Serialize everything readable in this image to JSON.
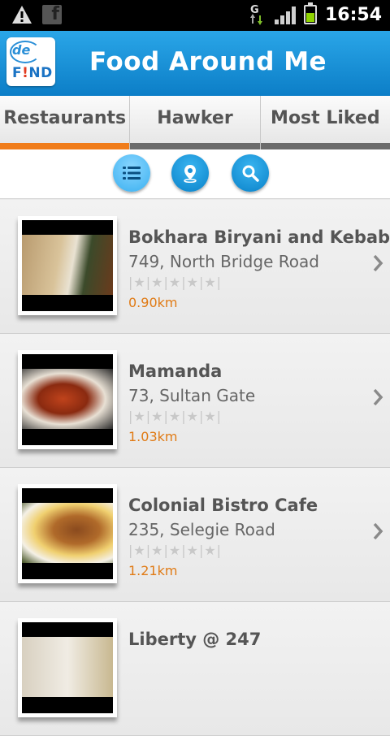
{
  "status_bar": {
    "time": "16:54",
    "icons": [
      "warning-icon",
      "facebook-icon",
      "network-g-icon",
      "signal-icon",
      "battery-icon"
    ]
  },
  "header": {
    "logo_de": "de",
    "logo_find": "FIND",
    "title": "Food Around Me",
    "color": "#1a93dc"
  },
  "tabs": [
    {
      "label": "Restaurants",
      "active": true
    },
    {
      "label": "Hawker",
      "active": false
    },
    {
      "label": "Most Liked",
      "active": false
    }
  ],
  "toolbar": {
    "buttons": [
      {
        "icon": "list-icon",
        "active": true
      },
      {
        "icon": "map-pin-icon",
        "active": false
      },
      {
        "icon": "search-icon",
        "active": false
      }
    ]
  },
  "restaurants": [
    {
      "name": "Bokhara Biryani and Kebab",
      "address": "749, North Bridge Road",
      "rating": 0,
      "distance": "0.90km"
    },
    {
      "name": "Mamanda",
      "address": "73, Sultan Gate",
      "rating": 0,
      "distance": "1.03km"
    },
    {
      "name": "Colonial Bistro Cafe",
      "address": "235, Selegie Road",
      "rating": 0,
      "distance": "1.21km"
    },
    {
      "name": "Liberty @ 247",
      "address": "",
      "rating": 0,
      "distance": ""
    }
  ],
  "accent_color": "#f07c1a"
}
